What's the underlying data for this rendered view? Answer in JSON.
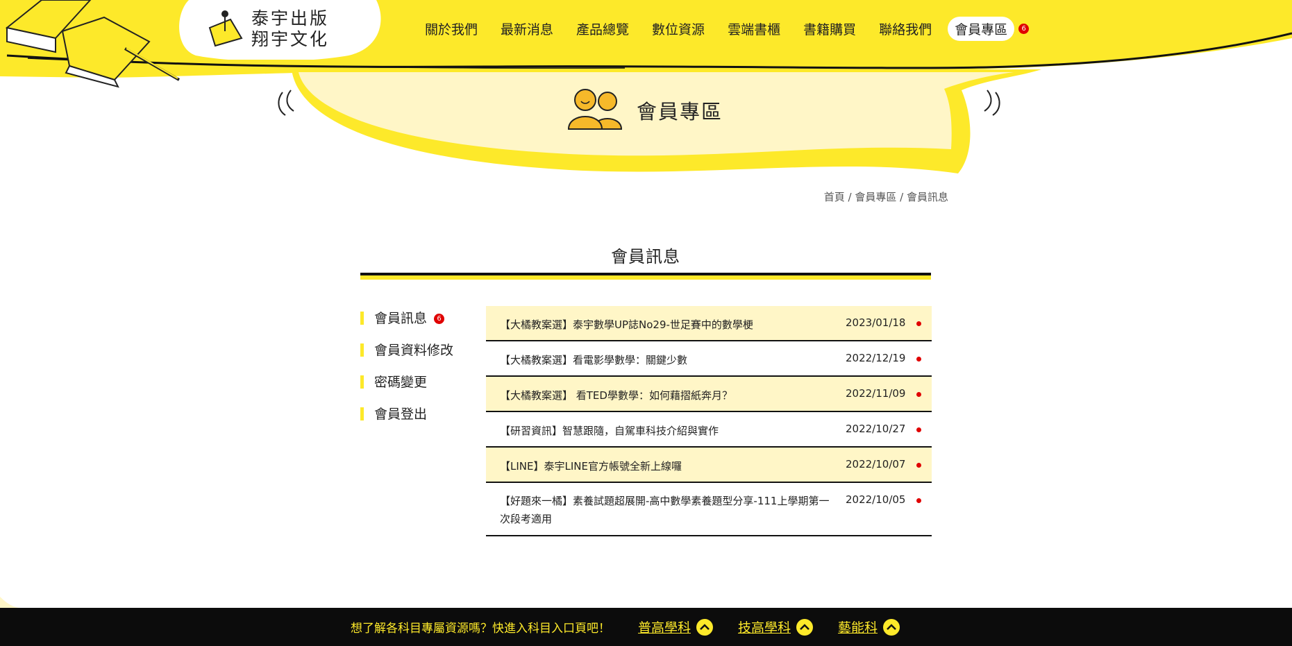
{
  "brand": {
    "line1": "泰宇出版",
    "line2": "翔宇文化",
    "accent": "#fde92a",
    "badge_color": "#e00000"
  },
  "nav": {
    "items": [
      {
        "label": "關於我們"
      },
      {
        "label": "最新消息"
      },
      {
        "label": "產品總覽"
      },
      {
        "label": "數位資源"
      },
      {
        "label": "雲端書櫃"
      },
      {
        "label": "書籍購買"
      },
      {
        "label": "聯絡我們"
      },
      {
        "label": "會員專區"
      }
    ],
    "member_badge": "6"
  },
  "hero": {
    "title": "會員專區",
    "icon": "members-icon"
  },
  "breadcrumb": {
    "home": "首頁",
    "section": "會員專區",
    "current": "會員訊息",
    "separator": "/"
  },
  "page": {
    "title": "會員訊息"
  },
  "side_menu": {
    "items": [
      {
        "label": "會員訊息",
        "badge": "6"
      },
      {
        "label": "會員資料修改"
      },
      {
        "label": "密碼變更"
      },
      {
        "label": "會員登出"
      }
    ]
  },
  "messages": [
    {
      "title": "【大橘教案選】泰宇數學UP誌No29-世足賽中的數學梗",
      "date": "2023/01/18",
      "unread": true
    },
    {
      "title": "【大橘教案選】看電影學數學：關鍵少數",
      "date": "2022/12/19",
      "unread": true
    },
    {
      "title": "【大橘教案選】 看TED學數學：如何藉摺紙奔月？",
      "date": "2022/11/09",
      "unread": true
    },
    {
      "title": "【研習資訊】智慧跟隨，自駕車科技介紹與實作",
      "date": "2022/10/27",
      "unread": true
    },
    {
      "title": "【LINE】泰宇LINE官方帳號全新上線囉",
      "date": "2022/10/07",
      "unread": true
    },
    {
      "title": "【好題來一橘】素養試題超展開-高中數學素養題型分享-111上學期第一次段考適用",
      "date": "2022/10/05",
      "unread": true
    }
  ],
  "footer": {
    "message": "想了解各科目專屬資源嗎？快進入科目入口頁吧！",
    "links": [
      {
        "label": "普高學科"
      },
      {
        "label": "技高學科"
      },
      {
        "label": "藝能科"
      }
    ]
  }
}
